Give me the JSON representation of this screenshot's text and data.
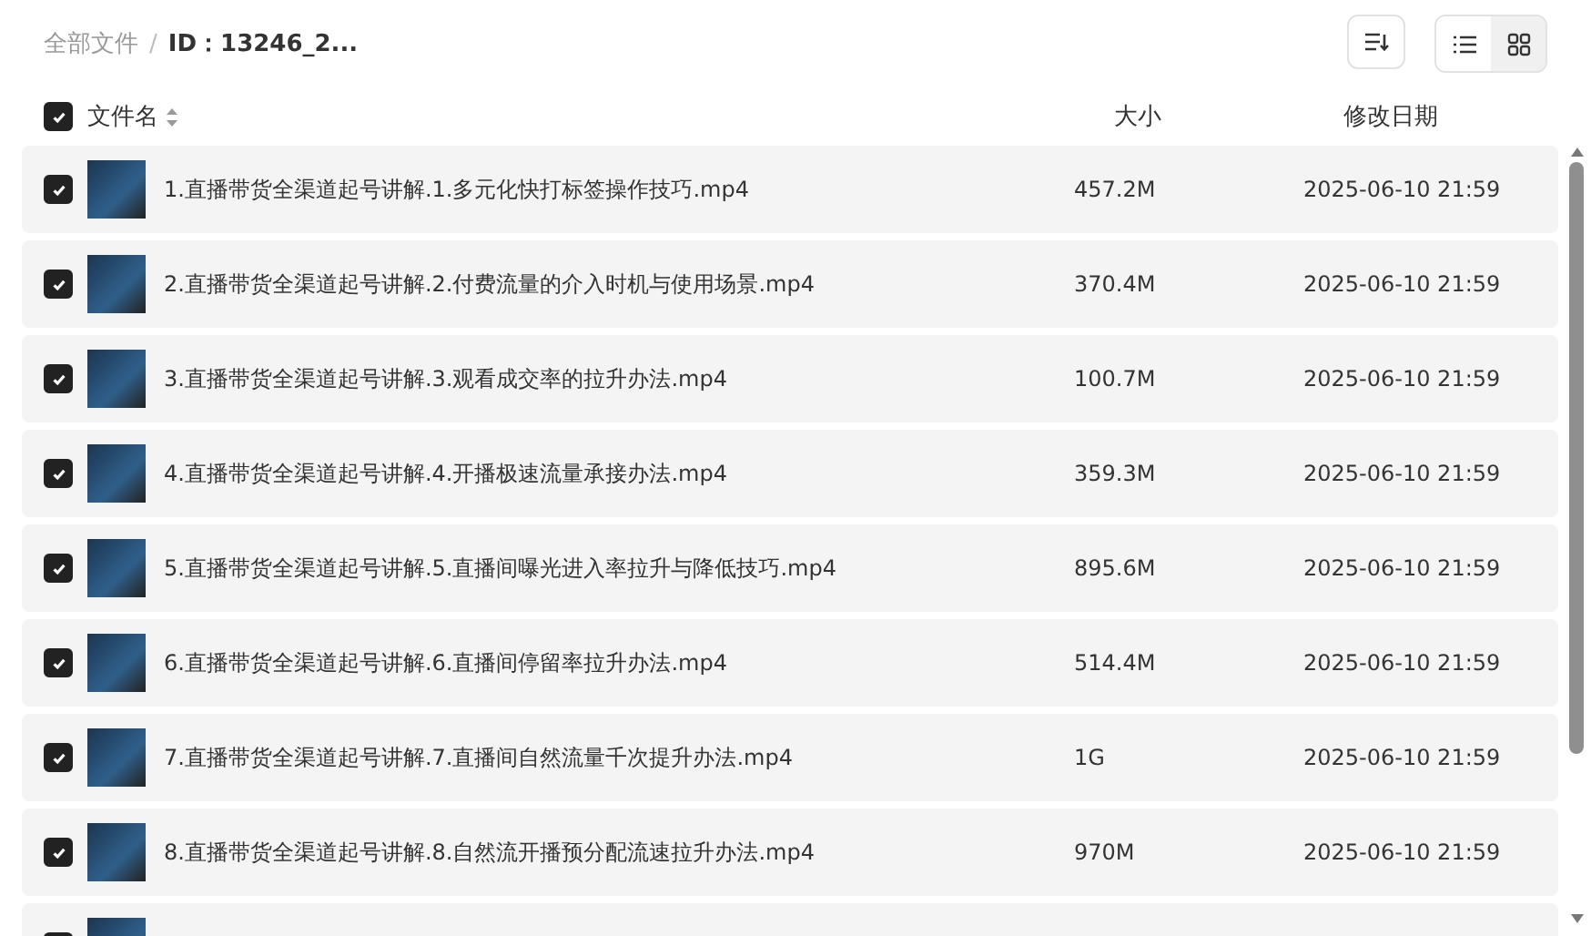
{
  "breadcrumb": {
    "root": "全部文件",
    "separator": "/",
    "current": "ID：13246_2..."
  },
  "view_buttons": [
    {
      "kind": "list",
      "selected": true
    },
    {
      "kind": "grid",
      "selected": false
    }
  ],
  "header": {
    "checked": true,
    "columns": [
      "文件名",
      "大小",
      "修改日期"
    ]
  },
  "rows": [
    {
      "checked": true,
      "name": "1.直播带货全渠道起号讲解.1.多元化快打标签操作技巧.mp4",
      "size": "457.2M",
      "date": "2025-06-10 21:59"
    },
    {
      "checked": true,
      "name": "2.直播带货全渠道起号讲解.2.付费流量的介入时机与使用场景.mp4",
      "size": "370.4M",
      "date": "2025-06-10 21:59"
    },
    {
      "checked": true,
      "name": "3.直播带货全渠道起号讲解.3.观看成交率的拉升办法.mp4",
      "size": "100.7M",
      "date": "2025-06-10 21:59"
    },
    {
      "checked": true,
      "name": "4.直播带货全渠道起号讲解.4.开播极速流量承接办法.mp4",
      "size": "359.3M",
      "date": "2025-06-10 21:59"
    },
    {
      "checked": true,
      "name": "5.直播带货全渠道起号讲解.5.直播间曝光进入率拉升与降低技巧.mp4",
      "size": "895.6M",
      "date": "2025-06-10 21:59"
    },
    {
      "checked": true,
      "name": "6.直播带货全渠道起号讲解.6.直播间停留率拉升办法.mp4",
      "size": "514.4M",
      "date": "2025-06-10 21:59"
    },
    {
      "checked": true,
      "name": "7.直播带货全渠道起号讲解.7.直播间自然流量千次提升办法.mp4",
      "size": "1G",
      "date": "2025-06-10 21:59"
    },
    {
      "checked": true,
      "name": "8.直播带货全渠道起号讲解.8.自然流开播预分配流速拉升办法.mp4",
      "size": "970M",
      "date": "2025-06-10 21:59"
    },
    {
      "checked": true
    }
  ]
}
